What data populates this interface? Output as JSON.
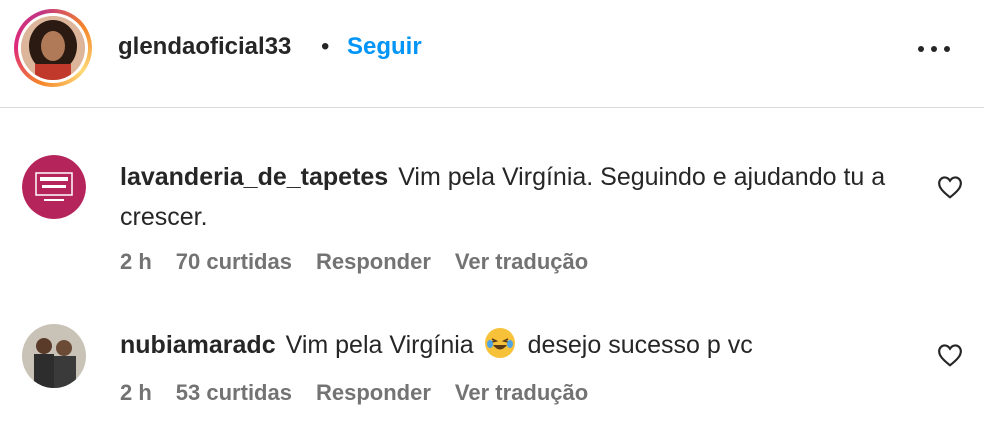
{
  "header": {
    "username": "glendaoficial33",
    "separator": "•",
    "follow_label": "Seguir",
    "more_icon": "more-horizontal-icon"
  },
  "comments": [
    {
      "username": "lavanderia_de_tapetes",
      "text": "Vim pela Virgínia. Seguindo e ajudando tu a crescer.",
      "time": "2 h",
      "likes": "70 curtidas",
      "reply_label": "Responder",
      "translate_label": "Ver tradução",
      "like_icon": "heart-icon"
    },
    {
      "username": "nubiamaradc",
      "text_before": "Vim pela Virgínia",
      "emoji": "😂",
      "text_after": "desejo sucesso p vc",
      "time": "2 h",
      "likes": "53 curtidas",
      "reply_label": "Responder",
      "translate_label": "Ver tradução",
      "like_icon": "heart-icon"
    }
  ],
  "colors": {
    "accent": "#0095f6",
    "text": "#262626",
    "secondary": "#737373",
    "divider": "#dbdbdb"
  }
}
